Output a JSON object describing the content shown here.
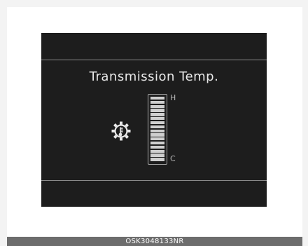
{
  "display": {
    "title": "Transmission Temp.",
    "gauge": {
      "high_label": "H",
      "low_label": "C",
      "segment_count": 16,
      "level": 1.0
    }
  },
  "caption": "OSK3048133NR",
  "icons": {
    "indicator": "transmission-temperature-icon"
  },
  "colors": {
    "screen": "#1d1d1d",
    "foreground": "#e9e9e9",
    "caption_bar": "#6d6d6d"
  }
}
